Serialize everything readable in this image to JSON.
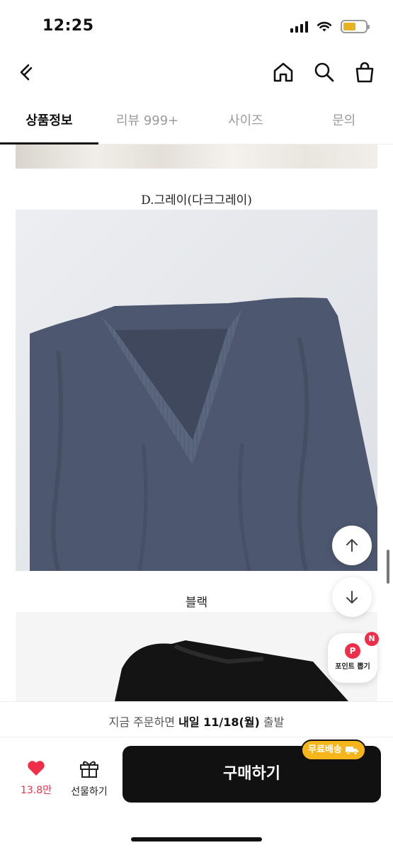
{
  "status_bar": {
    "time": "12:25"
  },
  "tabs": [
    {
      "label": "상품정보",
      "active": true
    },
    {
      "label": "리뷰 999+",
      "active": false
    },
    {
      "label": "사이즈",
      "active": false
    },
    {
      "label": "문의",
      "active": false
    }
  ],
  "content": {
    "captions": [
      "D.그레이(다크그레이)",
      "블랙"
    ]
  },
  "floating": {
    "point_label": "포인트 뽑기",
    "point_icon_letter": "P",
    "badge": "N"
  },
  "bottom_bar": {
    "shipping_prefix": "지금 주문하면 ",
    "shipping_highlight": "내일 11/18(월)",
    "shipping_suffix": " 출발",
    "like_count": "13.8만",
    "gift_label": "선물하기",
    "buy_label": "구매하기",
    "free_shipping_label": "무료배송"
  },
  "colors": {
    "accent_red": "#ef2f4a",
    "free_shipping": "#f5b51b",
    "battery": "#e6b31e"
  }
}
